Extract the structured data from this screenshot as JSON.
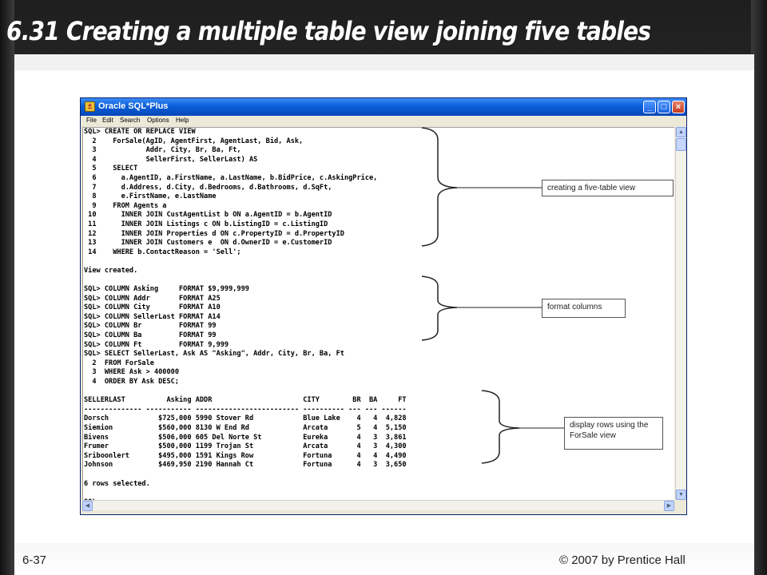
{
  "slide": {
    "title": "6.31 Creating a multiple table view joining five tables",
    "number": "6-37",
    "copyright": "© 2007 by Prentice Hall"
  },
  "window": {
    "title": "Oracle SQL*Plus",
    "icon": "sqlplus-icon",
    "menu": [
      "File",
      "Edit",
      "Search",
      "Options",
      "Help"
    ],
    "buttons": {
      "minimize": "_",
      "maximize": "□",
      "close": "×"
    }
  },
  "console_lines": [
    "SQL> CREATE OR REPLACE VIEW",
    "  2    ForSale(AgID, AgentFirst, AgentLast, Bid, Ask,",
    "  3            Addr, City, Br, Ba, Ft,",
    "  4            SellerFirst, SellerLast) AS",
    "  5    SELECT",
    "  6      a.AgentID, a.FirstName, a.LastName, b.BidPrice, c.AskingPrice,",
    "  7      d.Address, d.City, d.Bedrooms, d.Bathrooms, d.SqFt,",
    "  8      e.FirstName, e.LastName",
    "  9    FROM Agents a",
    " 10      INNER JOIN CustAgentList b ON a.AgentID = b.AgentID",
    " 11      INNER JOIN Listings c ON b.ListingID = c.ListingID",
    " 12      INNER JOIN Properties d ON c.PropertyID = d.PropertyID",
    " 13      INNER JOIN Customers e  ON d.OwnerID = e.CustomerID",
    " 14    WHERE b.ContactReason = 'Sell';",
    "",
    "View created.",
    "",
    "SQL> COLUMN Asking     FORMAT $9,999,999",
    "SQL> COLUMN Addr       FORMAT A25",
    "SQL> COLUMN City       FORMAT A10",
    "SQL> COLUMN SellerLast FORMAT A14",
    "SQL> COLUMN Br         FORMAT 99",
    "SQL> COLUMN Ba         FORMAT 99",
    "SQL> COLUMN Ft         FORMAT 9,999",
    "SQL> SELECT SellerLast, Ask AS \"Asking\", Addr, City, Br, Ba, Ft",
    "  2  FROM ForSale",
    "  3  WHERE Ask > 400000",
    "  4  ORDER BY Ask DESC;",
    "",
    "SELLERLAST          Asking ADDR                      CITY        BR  BA     FT",
    "-------------- ----------- ------------------------- ---------- --- --- ------",
    "Dorsch            $725,000 5990 Stover Rd            Blue Lake    4   4  4,828",
    "Siemion           $560,000 8130 W End Rd             Arcata       5   4  5,150",
    "Bivens            $506,000 605 Del Norte St          Eureka       4   3  3,861",
    "Frumer            $500,000 1199 Trojan St            Arcata       4   3  4,300",
    "Sriboonlert       $495,000 1591 Kings Row            Fortuna      4   4  4,490",
    "Johnson           $469,950 2190 Hannah Ct            Fortuna      4   3  3,650",
    "",
    "6 rows selected.",
    "",
    "SQL>"
  ],
  "callouts": {
    "view": "creating a five-table view",
    "format": "format columns",
    "display": "display rows using the ForSale view"
  }
}
